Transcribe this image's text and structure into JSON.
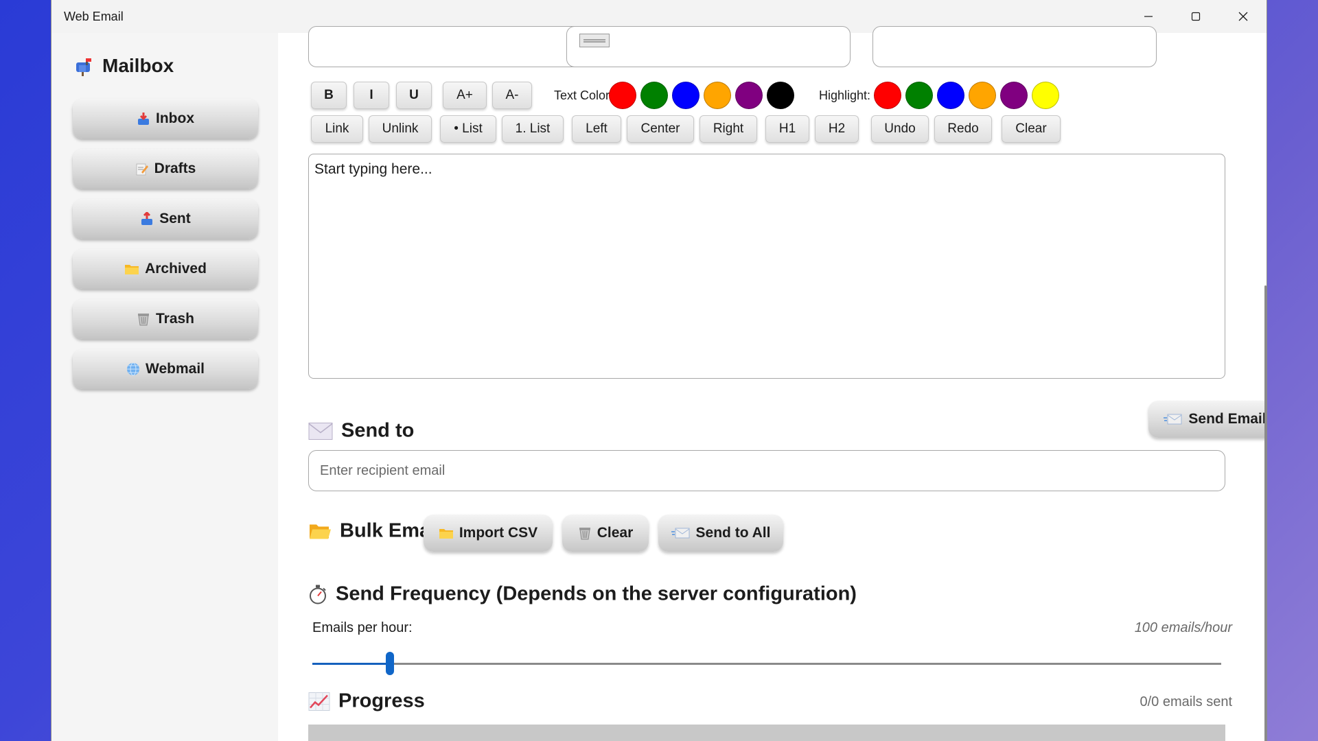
{
  "window": {
    "title": "Web Email"
  },
  "sidebar": {
    "title": "Mailbox",
    "items": [
      {
        "label": "Inbox",
        "icon": "inbox-tray-icon"
      },
      {
        "label": "Drafts",
        "icon": "memo-icon"
      },
      {
        "label": "Sent",
        "icon": "outbox-tray-icon"
      },
      {
        "label": "Archived",
        "icon": "folder-icon"
      },
      {
        "label": "Trash",
        "icon": "wastebasket-icon"
      },
      {
        "label": "Webmail",
        "icon": "globe-icon"
      }
    ]
  },
  "toolbar": {
    "format_buttons": [
      "B",
      "I",
      "U",
      "A+",
      "A-"
    ],
    "text_color_label": "Text Color:",
    "highlight_label": "Highlight:",
    "text_colors": [
      "#ff0000",
      "#008000",
      "#0000ff",
      "#ffa500",
      "#800080",
      "#000000"
    ],
    "highlight_colors": [
      "#ff0000",
      "#008000",
      "#0000ff",
      "#ffa500",
      "#800080",
      "#ffff00"
    ],
    "row2_buttons": [
      "Link",
      "Unlink",
      "• List",
      "1. List",
      "Left",
      "Center",
      "Right",
      "H1",
      "H2",
      "Undo",
      "Redo",
      "Clear"
    ]
  },
  "editor": {
    "placeholder": "Start typing here..."
  },
  "send_to": {
    "title": "Send to",
    "send_button": "Send Email",
    "recipient_placeholder": "Enter recipient email"
  },
  "bulk": {
    "title": "Bulk Email",
    "import_button": "Import CSV",
    "clear_button": "Clear",
    "send_all_button": "Send to All"
  },
  "frequency": {
    "title": "Send Frequency (Depends on the server configuration)",
    "label": "Emails per hour:",
    "value_text": "100 emails/hour",
    "slider_fraction": 0.085
  },
  "progress": {
    "title": "Progress",
    "status_text": "0/0 emails sent",
    "fraction": 0
  }
}
